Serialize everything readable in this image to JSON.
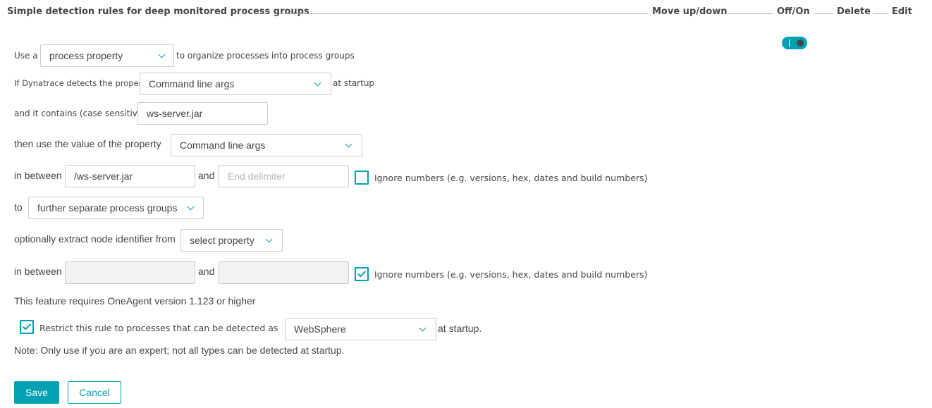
{
  "header": {
    "title": "Simple detection rules for deep monitored process groups",
    "move": "Move up/down",
    "offon": "Off/On",
    "delete": "Delete",
    "edit": "Edit"
  },
  "rule": {
    "enabled": true,
    "row1": {
      "prefix": "Use a",
      "select": "process property",
      "suffix": "to organize processes into process groups"
    },
    "row2": {
      "prefix": "If Dynatrace detects the property",
      "select": "Command line args",
      "suffix": "at startup"
    },
    "row3": {
      "prefix": "and it contains (case sensitive)",
      "value": "ws-server.jar"
    },
    "row4": {
      "prefix": "then use the value of the property",
      "select": "Command line args"
    },
    "row5": {
      "prefix": "in between",
      "start_value": "/ws-server.jar",
      "and": "and",
      "end_placeholder": "End delimiter",
      "ignore_checked": false,
      "ignore_label": "Ignore numbers (e.g. versions, hex, dates and build numbers)"
    },
    "row6": {
      "prefix": "to",
      "select": "further separate process groups"
    },
    "row7": {
      "prefix": "optionally extract node identifier from",
      "select": "select property"
    },
    "row8": {
      "prefix": "in between",
      "and": "and",
      "ignore_checked": true,
      "ignore_label": "Ignore numbers (e.g. versions, hex, dates and build numbers)"
    },
    "feature_note": "This feature requires OneAgent version 1.123 or higher",
    "restrict": {
      "checked": true,
      "label": "Restrict this rule to processes that can be detected as",
      "select": "WebSphere",
      "suffix": "at startup."
    },
    "note": "Note: Only use if you are an expert; not all types can be detected at startup."
  },
  "actions": {
    "save": "Save",
    "cancel": "Cancel"
  },
  "colors": {
    "accent": "#00a1b2",
    "text": "#454646",
    "border": "#cccccc"
  }
}
